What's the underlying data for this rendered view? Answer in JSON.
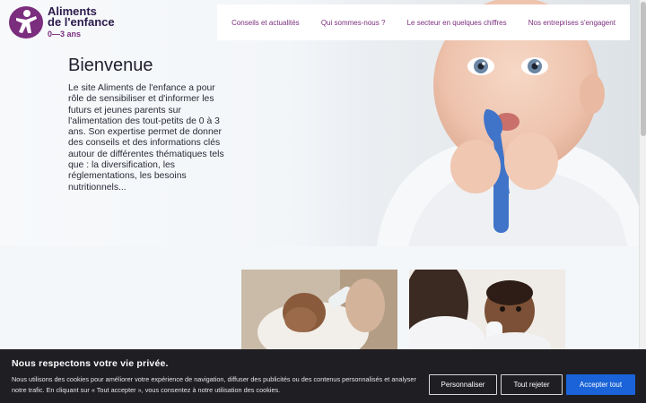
{
  "logo": {
    "line1": "Aliments",
    "line2": "de l'enfance",
    "line3": "0—3 ans"
  },
  "nav": {
    "items": [
      {
        "label": "Conseils et actualités"
      },
      {
        "label": "Qui sommes-nous ?"
      },
      {
        "label": "Le secteur en quelques chiffres"
      },
      {
        "label": "Nos entreprises s'engagent"
      }
    ]
  },
  "hero": {
    "title": "Bienvenue",
    "text": "Le site Aliments de l'enfance a pour rôle de sensibiliser et d'informer les futurs et jeunes parents sur l'alimentation des tout-petits de 0 à 3 ans. Son expertise permet de donner des conseils et des informations clés autour de différentes thématiques tels que : la diversification, les réglementations, les besoins nutritionnels..."
  },
  "cookie": {
    "title": "Nous respectons votre vie privée.",
    "text": "Nous utilisons des cookies pour améliorer votre expérience de navigation, diffuser des publicités ou des contenus personnalisés et analyser notre trafic. En cliquant sur « Tout accepter », vous consentez à notre utilisation des cookies.",
    "buttons": {
      "customize": "Personnaliser",
      "reject": "Tout rejeter",
      "accept": "Accepter tout"
    }
  },
  "colors": {
    "brand": "#7b2d7e",
    "accept": "#1a63d8",
    "banner": "#1e1e23"
  }
}
